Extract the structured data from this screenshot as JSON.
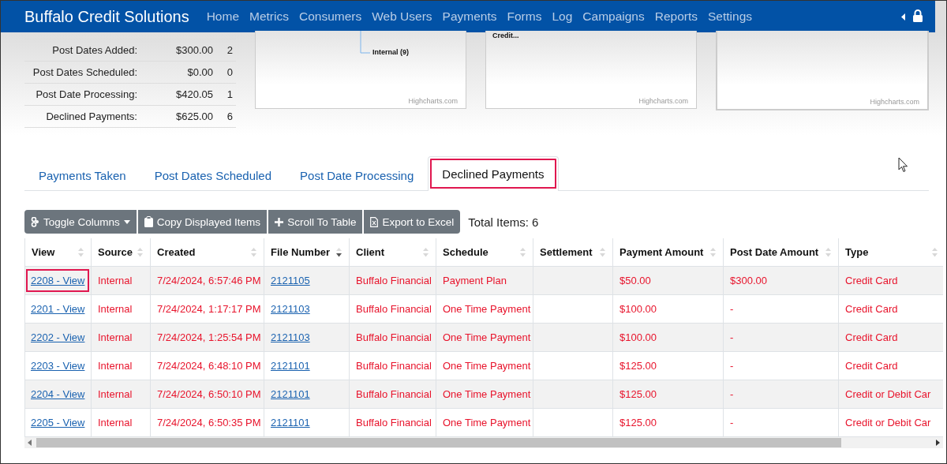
{
  "navbar": {
    "brand": "Buffalo Credit Solutions",
    "items": [
      "Home",
      "Metrics",
      "Consumers",
      "Web Users",
      "Payments",
      "Forms",
      "Log",
      "Campaigns",
      "Reports",
      "Settings"
    ]
  },
  "summary": [
    {
      "label": "Post Dates Added:",
      "amount": "$300.00",
      "count": "2"
    },
    {
      "label": "Post Dates Scheduled:",
      "amount": "$0.00",
      "count": "0"
    },
    {
      "label": "Post Date Processing:",
      "amount": "$420.05",
      "count": "1"
    },
    {
      "label": "Declined Payments:",
      "amount": "$625.00",
      "count": "6"
    }
  ],
  "charts": [
    {
      "label": "Internal (9)",
      "credit": "Highcharts.com"
    },
    {
      "label": "Credit...",
      "credit": "Highcharts.com"
    },
    {
      "credit": "Highcharts.com"
    }
  ],
  "tabs": [
    {
      "label": "Payments Taken",
      "selected": false,
      "highlighted": false
    },
    {
      "label": "Post Dates Scheduled",
      "selected": false,
      "highlighted": false
    },
    {
      "label": "Post Date Processing",
      "selected": false,
      "highlighted": false
    },
    {
      "label": "Declined Payments",
      "selected": true,
      "highlighted": true
    }
  ],
  "toolbar": {
    "buttons": [
      {
        "kind": "toggle",
        "label": "Toggle Columns"
      },
      {
        "kind": "copy",
        "label": "Copy Displayed Items"
      },
      {
        "kind": "scroll",
        "label": "Scroll To Table"
      },
      {
        "kind": "excel",
        "label": "Export to Excel"
      }
    ],
    "total": "Total Items: 6"
  },
  "table": {
    "columns": [
      {
        "label": "View",
        "sorted": false
      },
      {
        "label": "Source",
        "sorted": false
      },
      {
        "label": "Created",
        "sorted": false
      },
      {
        "label": "File Number",
        "sorted": true
      },
      {
        "label": "Client",
        "sorted": false
      },
      {
        "label": "Schedule",
        "sorted": false
      },
      {
        "label": "Settlement",
        "sorted": false
      },
      {
        "label": "Payment Amount",
        "sorted": false
      },
      {
        "label": "Post Date Amount",
        "sorted": false
      },
      {
        "label": "Type",
        "sorted": false
      }
    ],
    "rows": [
      {
        "view": "2208 - View",
        "highlighted": true,
        "source": "Internal",
        "created": "7/24/2024, 6:57:46 PM",
        "file_number": "2121105",
        "client": "Buffalo Financial",
        "schedule": "Payment Plan",
        "settlement": "",
        "payment_amount": "$50.00",
        "post_date_amount": "$300.00",
        "type": "Credit Card"
      },
      {
        "view": "2201 - View",
        "highlighted": false,
        "source": "Internal",
        "created": "7/24/2024, 1:17:17 PM",
        "file_number": "2121103",
        "client": "Buffalo Financial",
        "schedule": "One Time Payment",
        "settlement": "",
        "payment_amount": "$100.00",
        "post_date_amount": "-",
        "type": "Credit Card"
      },
      {
        "view": "2202 - View",
        "highlighted": false,
        "source": "Internal",
        "created": "7/24/2024, 1:25:54 PM",
        "file_number": "2121103",
        "client": "Buffalo Financial",
        "schedule": "One Time Payment",
        "settlement": "",
        "payment_amount": "$100.00",
        "post_date_amount": "-",
        "type": "Credit Card"
      },
      {
        "view": "2203 - View",
        "highlighted": false,
        "source": "Internal",
        "created": "7/24/2024, 6:48:10 PM",
        "file_number": "2121101",
        "client": "Buffalo Financial",
        "schedule": "One Time Payment",
        "settlement": "",
        "payment_amount": "$125.00",
        "post_date_amount": "-",
        "type": "Credit Card"
      },
      {
        "view": "2204 - View",
        "highlighted": false,
        "source": "Internal",
        "created": "7/24/2024, 6:50:10 PM",
        "file_number": "2121101",
        "client": "Buffalo Financial",
        "schedule": "One Time Payment",
        "settlement": "",
        "payment_amount": "$125.00",
        "post_date_amount": "-",
        "type": "Credit or Debit Car"
      },
      {
        "view": "2205 - View",
        "highlighted": false,
        "source": "Internal",
        "created": "7/24/2024, 6:50:35 PM",
        "file_number": "2121101",
        "client": "Buffalo Financial",
        "schedule": "One Time Payment",
        "settlement": "",
        "payment_amount": "$125.00",
        "post_date_amount": "-",
        "type": "Credit or Debit Car"
      }
    ]
  }
}
